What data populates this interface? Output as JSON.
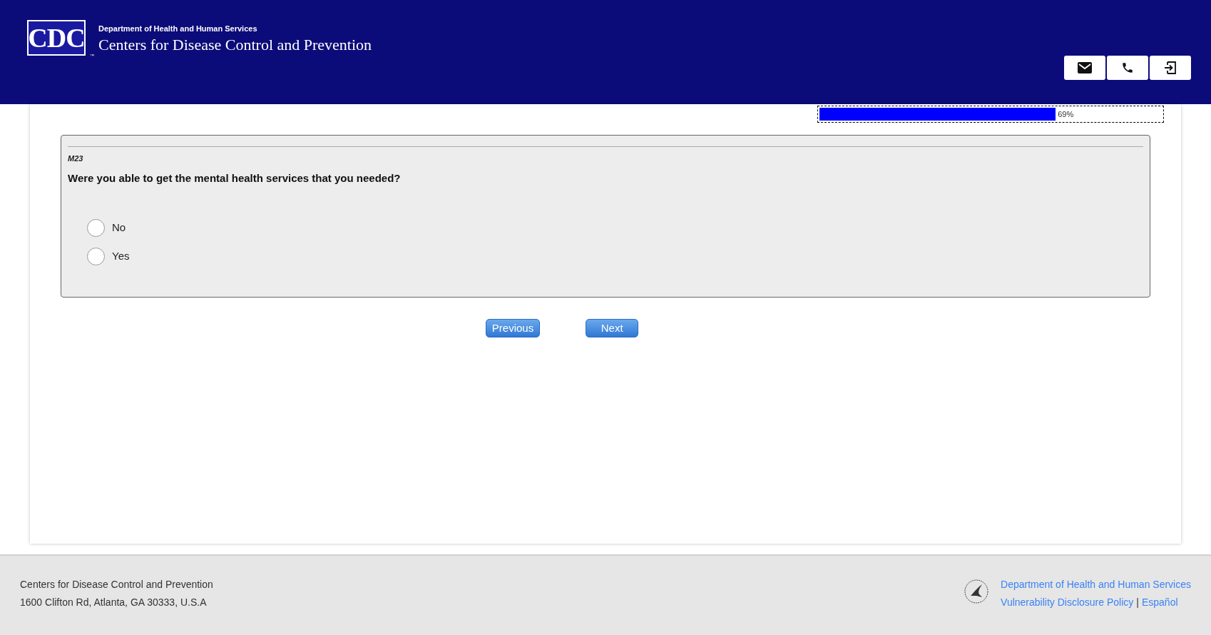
{
  "header": {
    "logo_text": "CDC",
    "logo_mark": "™",
    "department": "Department of Health and Human Services",
    "agency": "Centers for Disease Control and Prevention",
    "buttons": [
      {
        "kind": "mail"
      },
      {
        "kind": "phone"
      },
      {
        "kind": "exit"
      }
    ]
  },
  "progress": {
    "level": 0.69,
    "reading": "69%"
  },
  "question": {
    "code": "M23",
    "text": "Were you able to get the mental health services that you needed?",
    "options": [
      {
        "label": "No",
        "selected": false
      },
      {
        "label": "Yes",
        "selected": false
      }
    ]
  },
  "nav_buttons": [
    "Previous",
    "Next"
  ],
  "footer": {
    "address": [
      "Centers for Disease Control and Prevention",
      "1600 Clifton Rd, Atlanta, GA 30333, U.S.A"
    ],
    "links": [
      "Department of Health and Human Services",
      "Vulnerability Disclosure Policy",
      "Español"
    ],
    "separator": "|"
  }
}
